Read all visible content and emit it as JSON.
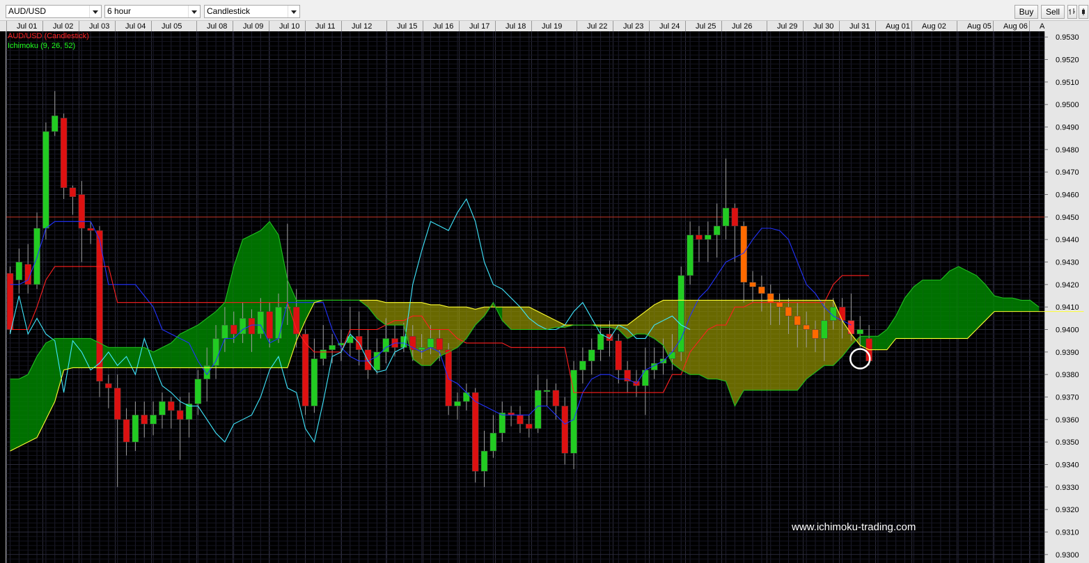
{
  "toolbar": {
    "symbol": "AUD/USD",
    "interval": "6 hour",
    "chart_type": "Candlestick",
    "buy_label": "Buy",
    "sell_label": "Sell",
    "icons": [
      "bar-chart-icon",
      "candle-chart-icon"
    ]
  },
  "chart_data": {
    "type": "candlestick",
    "symbol": "AUD/USD",
    "interval": "6 hour",
    "legend": [
      {
        "name": "AUD/USD (Candlestick)",
        "color": "#ff2020"
      },
      {
        "name": "Ichimoku (9, 26, 52)",
        "color": "#20ff20"
      }
    ],
    "x_tick_labels": [
      "Jul 01",
      "Jul 02",
      "Jul 03",
      "Jul 04",
      "Jul 05",
      "Jul 08",
      "Jul 09",
      "Jul 10",
      "Jul 11",
      "Jul 12",
      "Jul 15",
      "Jul 16",
      "Jul 17",
      "Jul 18",
      "Jul 19",
      "Jul 22",
      "Jul 23",
      "Jul 24",
      "Jul 25",
      "Jul 26",
      "Jul 29",
      "Jul 30",
      "Jul 31",
      "Aug 01",
      "Aug 02",
      "Aug 05",
      "Aug 06",
      "A"
    ],
    "y_range": [
      0.9297,
      0.9533
    ],
    "y_ticks": [
      "0.9530",
      "0.9520",
      "0.9510",
      "0.9500",
      "0.9490",
      "0.9480",
      "0.9470",
      "0.9460",
      "0.9450",
      "0.9440",
      "0.9430",
      "0.9420",
      "0.9410",
      "0.9400",
      "0.9390",
      "0.9380",
      "0.9370",
      "0.9360",
      "0.9350",
      "0.9340",
      "0.9330",
      "0.9320",
      "0.9310",
      "0.9300"
    ],
    "horizontal_line": 0.945,
    "candles": [
      [
        0.9425,
        0.94,
        0.9428,
        0.9398
      ],
      [
        0.9422,
        0.943,
        0.9436,
        0.9416
      ],
      [
        0.9429,
        0.942,
        0.9438,
        0.9416
      ],
      [
        0.942,
        0.9445,
        0.9452,
        0.9418
      ],
      [
        0.9445,
        0.9488,
        0.9492,
        0.944
      ],
      [
        0.9488,
        0.9495,
        0.9506,
        0.9486
      ],
      [
        0.9494,
        0.9463,
        0.9496,
        0.9458
      ],
      [
        0.9463,
        0.9459,
        0.9464,
        0.9451
      ],
      [
        0.946,
        0.9445,
        0.9466,
        0.943
      ],
      [
        0.9445,
        0.9444,
        0.9448,
        0.9438
      ],
      [
        0.9444,
        0.9377,
        0.9446,
        0.937
      ],
      [
        0.9376,
        0.9374,
        0.938,
        0.9365
      ],
      [
        0.9374,
        0.936,
        0.938,
        0.933
      ],
      [
        0.936,
        0.935,
        0.9365,
        0.9344
      ],
      [
        0.935,
        0.9362,
        0.9368,
        0.9346
      ],
      [
        0.9362,
        0.9358,
        0.9368,
        0.9352
      ],
      [
        0.9358,
        0.9362,
        0.9368,
        0.9353
      ],
      [
        0.9362,
        0.9368,
        0.9372,
        0.9356
      ],
      [
        0.9368,
        0.9364,
        0.937,
        0.9356
      ],
      [
        0.9364,
        0.936,
        0.937,
        0.9342
      ],
      [
        0.936,
        0.9367,
        0.9372,
        0.9352
      ],
      [
        0.9367,
        0.9378,
        0.9382,
        0.9362
      ],
      [
        0.9378,
        0.9384,
        0.9392,
        0.9368
      ],
      [
        0.9384,
        0.9396,
        0.9402,
        0.9378
      ],
      [
        0.9396,
        0.9402,
        0.941,
        0.939
      ],
      [
        0.9402,
        0.9398,
        0.9408,
        0.9394
      ],
      [
        0.9398,
        0.9405,
        0.9412,
        0.9394
      ],
      [
        0.9405,
        0.9398,
        0.9409,
        0.939
      ],
      [
        0.9398,
        0.9408,
        0.9414,
        0.9396
      ],
      [
        0.9408,
        0.9396,
        0.9412,
        0.9392
      ],
      [
        0.9396,
        0.941,
        0.9416,
        0.9394
      ],
      [
        0.941,
        0.941,
        0.9447,
        0.9402
      ],
      [
        0.941,
        0.9398,
        0.9418,
        0.9392
      ],
      [
        0.9398,
        0.9366,
        0.94,
        0.9362
      ],
      [
        0.9366,
        0.9387,
        0.9396,
        0.9363
      ],
      [
        0.9387,
        0.9391,
        0.9402,
        0.9384
      ],
      [
        0.9391,
        0.9393,
        0.9398,
        0.9385
      ],
      [
        0.9393,
        0.9394,
        0.94,
        0.9386
      ],
      [
        0.9394,
        0.9397,
        0.941,
        0.9388
      ],
      [
        0.9397,
        0.9391,
        0.9408,
        0.9384
      ],
      [
        0.9391,
        0.9382,
        0.94,
        0.9378
      ],
      [
        0.9382,
        0.939,
        0.9396,
        0.938
      ],
      [
        0.939,
        0.9396,
        0.9405,
        0.9385
      ],
      [
        0.9396,
        0.9392,
        0.9402,
        0.9388
      ],
      [
        0.9392,
        0.9397,
        0.9403,
        0.939
      ],
      [
        0.9397,
        0.9391,
        0.9402,
        0.9386
      ],
      [
        0.9391,
        0.9392,
        0.9398,
        0.9387
      ],
      [
        0.9392,
        0.9396,
        0.9402,
        0.9389
      ],
      [
        0.9396,
        0.9391,
        0.94,
        0.9386
      ],
      [
        0.9391,
        0.9366,
        0.9394,
        0.9362
      ],
      [
        0.9366,
        0.9368,
        0.9372,
        0.936
      ],
      [
        0.9368,
        0.9372,
        0.9376,
        0.9364
      ],
      [
        0.9372,
        0.9337,
        0.9374,
        0.9332
      ],
      [
        0.9337,
        0.9346,
        0.9355,
        0.933
      ],
      [
        0.9346,
        0.9354,
        0.9362,
        0.9343
      ],
      [
        0.9354,
        0.9363,
        0.9368,
        0.935
      ],
      [
        0.9363,
        0.9362,
        0.9366,
        0.9357
      ],
      [
        0.9362,
        0.9358,
        0.9366,
        0.9354
      ],
      [
        0.9358,
        0.9356,
        0.9362,
        0.9352
      ],
      [
        0.9356,
        0.9373,
        0.938,
        0.9354
      ],
      [
        0.9373,
        0.9373,
        0.9378,
        0.9366
      ],
      [
        0.9373,
        0.9366,
        0.9376,
        0.936
      ],
      [
        0.9366,
        0.9345,
        0.937,
        0.934
      ],
      [
        0.9345,
        0.9382,
        0.9386,
        0.9338
      ],
      [
        0.9382,
        0.9386,
        0.9392,
        0.9376
      ],
      [
        0.9386,
        0.9391,
        0.9396,
        0.938
      ],
      [
        0.9391,
        0.9398,
        0.9402,
        0.9386
      ],
      [
        0.9398,
        0.9395,
        0.9404,
        0.9388
      ],
      [
        0.9395,
        0.9382,
        0.9398,
        0.9376
      ],
      [
        0.9382,
        0.9377,
        0.9386,
        0.9372
      ],
      [
        0.9377,
        0.9375,
        0.9382,
        0.937
      ],
      [
        0.9375,
        0.9382,
        0.9392,
        0.9362
      ],
      [
        0.9382,
        0.9385,
        0.9392,
        0.9378
      ],
      [
        0.9385,
        0.9387,
        0.9396,
        0.938
      ],
      [
        0.9387,
        0.939,
        0.9398,
        0.9382
      ],
      [
        0.939,
        0.9424,
        0.9428,
        0.9386
      ],
      [
        0.9424,
        0.9442,
        0.9448,
        0.942
      ],
      [
        0.9442,
        0.944,
        0.9446,
        0.943
      ],
      [
        0.944,
        0.9442,
        0.9448,
        0.943
      ],
      [
        0.9442,
        0.9446,
        0.9456,
        0.9432
      ],
      [
        0.9446,
        0.9454,
        0.9476,
        0.944
      ],
      [
        0.9454,
        0.9446,
        0.9456,
        0.943
      ],
      [
        0.9446,
        0.9421,
        0.9448,
        0.9412
      ],
      [
        0.9421,
        0.9419,
        0.9426,
        0.9412
      ],
      [
        0.9419,
        0.9416,
        0.9424,
        0.9408
      ],
      [
        0.9416,
        0.9412,
        0.942,
        0.9402
      ],
      [
        0.9412,
        0.941,
        0.9416,
        0.9402
      ],
      [
        0.941,
        0.9406,
        0.9414,
        0.9398
      ],
      [
        0.9406,
        0.9402,
        0.9412,
        0.9392
      ],
      [
        0.9402,
        0.94,
        0.9408,
        0.9392
      ],
      [
        0.94,
        0.9396,
        0.9404,
        0.939
      ],
      [
        0.9396,
        0.9404,
        0.9412,
        0.9386
      ],
      [
        0.9404,
        0.941,
        0.9414,
        0.94
      ],
      [
        0.941,
        0.9404,
        0.9414,
        0.9396
      ],
      [
        0.9404,
        0.9398,
        0.9416,
        0.9395
      ],
      [
        0.9398,
        0.94,
        0.9406,
        0.9392
      ],
      [
        0.9396,
        0.9386,
        0.9402,
        0.9384
      ]
    ],
    "series": [
      {
        "name": "Tenkan-sen",
        "color": "#2233ff",
        "x_start": 0,
        "values": [
          0.942,
          0.942,
          0.9422,
          0.9432,
          0.9445,
          0.9448,
          0.9448,
          0.9448,
          0.9448,
          0.9448,
          0.944,
          0.942,
          0.942,
          0.942,
          0.942,
          0.9415,
          0.941,
          0.94,
          0.9398,
          0.9396,
          0.9394,
          0.9386,
          0.938,
          0.9386,
          0.9396,
          0.9396,
          0.94,
          0.9402,
          0.9402,
          0.9394,
          0.9396,
          0.9412,
          0.9412,
          0.9412,
          0.9412,
          0.9412,
          0.94,
          0.9392,
          0.9388,
          0.9386,
          0.9386,
          0.9388,
          0.9392,
          0.9394,
          0.9394,
          0.9392,
          0.939,
          0.9392,
          0.939,
          0.9378,
          0.9376,
          0.9372,
          0.9368,
          0.9366,
          0.9364,
          0.9362,
          0.9362,
          0.9362,
          0.9362,
          0.9366,
          0.9366,
          0.9362,
          0.9358,
          0.936,
          0.9372,
          0.9378,
          0.938,
          0.938,
          0.9378,
          0.9378,
          0.9376,
          0.9382,
          0.9384,
          0.9386,
          0.939,
          0.9396,
          0.9406,
          0.9414,
          0.9418,
          0.9424,
          0.943,
          0.9432,
          0.9434,
          0.944,
          0.9445,
          0.9445,
          0.9444,
          0.944,
          0.943,
          0.942,
          0.9416,
          0.941,
          0.9406,
          0.9404,
          0.9402
        ]
      },
      {
        "name": "Kijun-sen",
        "color": "#ff2020",
        "x_start": 0,
        "values": [
          0.94,
          0.94,
          0.94,
          0.941,
          0.9422,
          0.9428,
          0.9428,
          0.9428,
          0.9428,
          0.9428,
          0.9428,
          0.9428,
          0.9412,
          0.9412,
          0.9412,
          0.9412,
          0.9412,
          0.9412,
          0.9412,
          0.9412,
          0.9412,
          0.9412,
          0.9412,
          0.9412,
          0.9412,
          0.9412,
          0.9412,
          0.9412,
          0.9412,
          0.9412,
          0.9412,
          0.9412,
          0.94,
          0.9394,
          0.939,
          0.939,
          0.939,
          0.939,
          0.94,
          0.94,
          0.94,
          0.94,
          0.9402,
          0.9404,
          0.9404,
          0.9406,
          0.9406,
          0.94,
          0.94,
          0.94,
          0.9396,
          0.9394,
          0.9394,
          0.9394,
          0.9394,
          0.9394,
          0.9392,
          0.9392,
          0.9392,
          0.9392,
          0.9392,
          0.9392,
          0.9392,
          0.9372,
          0.9372,
          0.9372,
          0.9372,
          0.9372,
          0.9372,
          0.9372,
          0.9372,
          0.9372,
          0.9372,
          0.9372,
          0.938,
          0.938,
          0.939,
          0.9395,
          0.94,
          0.9402,
          0.9402,
          0.941,
          0.941,
          0.9412,
          0.9412,
          0.9412,
          0.9412,
          0.9412,
          0.9412,
          0.9412,
          0.9412,
          0.9412,
          0.942,
          0.9424,
          0.9424,
          0.9424,
          0.9424
        ]
      },
      {
        "name": "Chikou Span",
        "color": "#40e8ff",
        "x_start": 0,
        "values": [
          0.9398,
          0.9415,
          0.9398,
          0.9405,
          0.9398,
          0.9395,
          0.9372,
          0.9395,
          0.939,
          0.9382,
          0.9385,
          0.939,
          0.9384,
          0.9388,
          0.938,
          0.9396,
          0.9385,
          0.9375,
          0.9372,
          0.9368,
          0.9366,
          0.9366,
          0.936,
          0.9354,
          0.935,
          0.9358,
          0.936,
          0.9362,
          0.937,
          0.9382,
          0.9388,
          0.9374,
          0.9372,
          0.9356,
          0.935,
          0.9368,
          0.9388,
          0.939,
          0.9398,
          0.9394,
          0.9386,
          0.9381,
          0.9382,
          0.939,
          0.9392,
          0.942,
          0.9435,
          0.9448,
          0.9446,
          0.9444,
          0.9452,
          0.9458,
          0.9448,
          0.943,
          0.942,
          0.9418,
          0.9414,
          0.941,
          0.9405,
          0.9402,
          0.94,
          0.94,
          0.9402,
          0.9408,
          0.9412,
          0.9405,
          0.9398,
          0.9396,
          0.9402,
          0.94,
          0.9396,
          0.9396,
          0.9402,
          0.9404,
          0.9406,
          0.9402,
          0.94
        ]
      },
      {
        "name": "Senkou Span A",
        "color": "#ffff30",
        "x_start": 0,
        "values": [
          0.9346,
          0.9348,
          0.935,
          0.9352,
          0.936,
          0.9368,
          0.9382,
          0.9383,
          0.9383,
          0.9383,
          0.9383,
          0.9383,
          0.9383,
          0.9383,
          0.9383,
          0.9383,
          0.9383,
          0.9383,
          0.9383,
          0.9383,
          0.9383,
          0.9383,
          0.9383,
          0.9383,
          0.9383,
          0.9383,
          0.9383,
          0.9383,
          0.9383,
          0.9383,
          0.9383,
          0.9383,
          0.9395,
          0.9404,
          0.9412,
          0.9413,
          0.9413,
          0.9413,
          0.9413,
          0.9413,
          0.9413,
          0.9413,
          0.9412,
          0.9412,
          0.9412,
          0.9412,
          0.9412,
          0.9411,
          0.9411,
          0.941,
          0.941,
          0.941,
          0.9409,
          0.941,
          0.941,
          0.941,
          0.941,
          0.941,
          0.941,
          0.9408,
          0.9406,
          0.9404,
          0.9402,
          0.9402,
          0.9402,
          0.9402,
          0.9402,
          0.9402,
          0.9402,
          0.9402,
          0.9405,
          0.9408,
          0.9411,
          0.9413,
          0.9413,
          0.9413,
          0.9413,
          0.9413,
          0.9413,
          0.9413,
          0.9413,
          0.9413,
          0.9413,
          0.9413,
          0.9413,
          0.9413,
          0.9413,
          0.9413,
          0.9413,
          0.9413,
          0.9413,
          0.9413,
          0.9413,
          0.9404,
          0.9398,
          0.9393,
          0.9391,
          0.9391,
          0.9391,
          0.9396,
          0.9396,
          0.9396,
          0.9396,
          0.9396,
          0.9396,
          0.9396,
          0.9396,
          0.9396,
          0.94,
          0.9404,
          0.9408,
          0.9408,
          0.9408,
          0.9408,
          0.9408,
          0.9408,
          0.9408,
          0.9408,
          0.9408,
          0.9408,
          0.9408
        ]
      },
      {
        "name": "Senkou Span B",
        "color": "#20c020",
        "x_start": 0,
        "values": [
          0.9378,
          0.9378,
          0.938,
          0.9388,
          0.9394,
          0.9396,
          0.9396,
          0.9396,
          0.9396,
          0.9396,
          0.9394,
          0.9392,
          0.9392,
          0.9392,
          0.9392,
          0.9392,
          0.939,
          0.9392,
          0.9394,
          0.9398,
          0.94,
          0.9402,
          0.9405,
          0.9408,
          0.9412,
          0.9428,
          0.944,
          0.9442,
          0.9444,
          0.9448,
          0.9442,
          0.9422,
          0.9413,
          0.9413,
          0.9413,
          0.9413,
          0.9413,
          0.9413,
          0.9413,
          0.9413,
          0.941,
          0.9405,
          0.9402,
          0.9402,
          0.9402,
          0.9387,
          0.9384,
          0.9384,
          0.9388,
          0.939,
          0.9392,
          0.9396,
          0.9402,
          0.9406,
          0.9412,
          0.9404,
          0.94,
          0.94,
          0.94,
          0.94,
          0.94,
          0.9401,
          0.9401,
          0.9402,
          0.9402,
          0.9402,
          0.9401,
          0.9401,
          0.94,
          0.9396,
          0.9398,
          0.9398,
          0.9396,
          0.9393,
          0.9385,
          0.9382,
          0.938,
          0.938,
          0.9378,
          0.9378,
          0.9377,
          0.9366,
          0.9373,
          0.9373,
          0.9373,
          0.9373,
          0.9373,
          0.9373,
          0.9373,
          0.9378,
          0.9381,
          0.9384,
          0.9384,
          0.9388,
          0.9393,
          0.9397,
          0.9397,
          0.9397,
          0.94,
          0.9406,
          0.9414,
          0.9419,
          0.9422,
          0.9422,
          0.9422,
          0.9426,
          0.9428,
          0.9426,
          0.9424,
          0.942,
          0.9415,
          0.9414,
          0.9414,
          0.9413,
          0.9413,
          0.941
        ]
      }
    ],
    "highlight_marker": {
      "candle_index": 95,
      "value": 0.9387
    },
    "watermark": "www.ichimoku-trading.com"
  }
}
